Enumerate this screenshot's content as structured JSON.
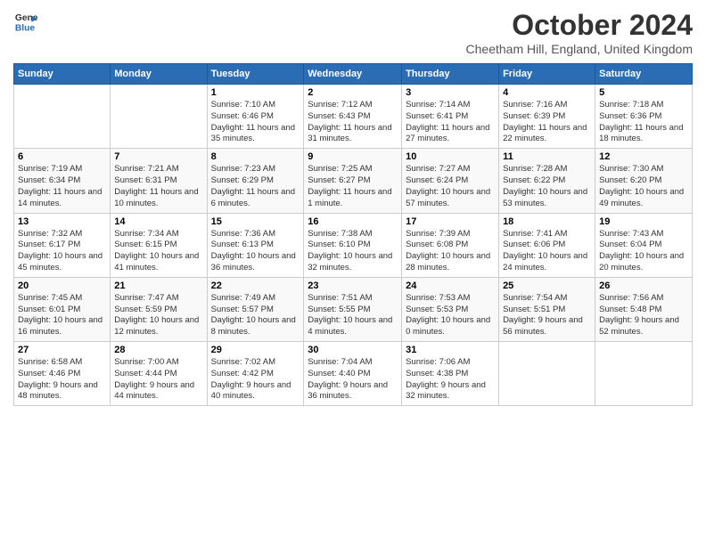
{
  "logo": {
    "line1": "General",
    "line2": "Blue"
  },
  "title": "October 2024",
  "subtitle": "Cheetham Hill, England, United Kingdom",
  "days_header": [
    "Sunday",
    "Monday",
    "Tuesday",
    "Wednesday",
    "Thursday",
    "Friday",
    "Saturday"
  ],
  "weeks": [
    [
      {
        "day": "",
        "info": ""
      },
      {
        "day": "",
        "info": ""
      },
      {
        "day": "1",
        "info": "Sunrise: 7:10 AM\nSunset: 6:46 PM\nDaylight: 11 hours and 35 minutes."
      },
      {
        "day": "2",
        "info": "Sunrise: 7:12 AM\nSunset: 6:43 PM\nDaylight: 11 hours and 31 minutes."
      },
      {
        "day": "3",
        "info": "Sunrise: 7:14 AM\nSunset: 6:41 PM\nDaylight: 11 hours and 27 minutes."
      },
      {
        "day": "4",
        "info": "Sunrise: 7:16 AM\nSunset: 6:39 PM\nDaylight: 11 hours and 22 minutes."
      },
      {
        "day": "5",
        "info": "Sunrise: 7:18 AM\nSunset: 6:36 PM\nDaylight: 11 hours and 18 minutes."
      }
    ],
    [
      {
        "day": "6",
        "info": "Sunrise: 7:19 AM\nSunset: 6:34 PM\nDaylight: 11 hours and 14 minutes."
      },
      {
        "day": "7",
        "info": "Sunrise: 7:21 AM\nSunset: 6:31 PM\nDaylight: 11 hours and 10 minutes."
      },
      {
        "day": "8",
        "info": "Sunrise: 7:23 AM\nSunset: 6:29 PM\nDaylight: 11 hours and 6 minutes."
      },
      {
        "day": "9",
        "info": "Sunrise: 7:25 AM\nSunset: 6:27 PM\nDaylight: 11 hours and 1 minute."
      },
      {
        "day": "10",
        "info": "Sunrise: 7:27 AM\nSunset: 6:24 PM\nDaylight: 10 hours and 57 minutes."
      },
      {
        "day": "11",
        "info": "Sunrise: 7:28 AM\nSunset: 6:22 PM\nDaylight: 10 hours and 53 minutes."
      },
      {
        "day": "12",
        "info": "Sunrise: 7:30 AM\nSunset: 6:20 PM\nDaylight: 10 hours and 49 minutes."
      }
    ],
    [
      {
        "day": "13",
        "info": "Sunrise: 7:32 AM\nSunset: 6:17 PM\nDaylight: 10 hours and 45 minutes."
      },
      {
        "day": "14",
        "info": "Sunrise: 7:34 AM\nSunset: 6:15 PM\nDaylight: 10 hours and 41 minutes."
      },
      {
        "day": "15",
        "info": "Sunrise: 7:36 AM\nSunset: 6:13 PM\nDaylight: 10 hours and 36 minutes."
      },
      {
        "day": "16",
        "info": "Sunrise: 7:38 AM\nSunset: 6:10 PM\nDaylight: 10 hours and 32 minutes."
      },
      {
        "day": "17",
        "info": "Sunrise: 7:39 AM\nSunset: 6:08 PM\nDaylight: 10 hours and 28 minutes."
      },
      {
        "day": "18",
        "info": "Sunrise: 7:41 AM\nSunset: 6:06 PM\nDaylight: 10 hours and 24 minutes."
      },
      {
        "day": "19",
        "info": "Sunrise: 7:43 AM\nSunset: 6:04 PM\nDaylight: 10 hours and 20 minutes."
      }
    ],
    [
      {
        "day": "20",
        "info": "Sunrise: 7:45 AM\nSunset: 6:01 PM\nDaylight: 10 hours and 16 minutes."
      },
      {
        "day": "21",
        "info": "Sunrise: 7:47 AM\nSunset: 5:59 PM\nDaylight: 10 hours and 12 minutes."
      },
      {
        "day": "22",
        "info": "Sunrise: 7:49 AM\nSunset: 5:57 PM\nDaylight: 10 hours and 8 minutes."
      },
      {
        "day": "23",
        "info": "Sunrise: 7:51 AM\nSunset: 5:55 PM\nDaylight: 10 hours and 4 minutes."
      },
      {
        "day": "24",
        "info": "Sunrise: 7:53 AM\nSunset: 5:53 PM\nDaylight: 10 hours and 0 minutes."
      },
      {
        "day": "25",
        "info": "Sunrise: 7:54 AM\nSunset: 5:51 PM\nDaylight: 9 hours and 56 minutes."
      },
      {
        "day": "26",
        "info": "Sunrise: 7:56 AM\nSunset: 5:48 PM\nDaylight: 9 hours and 52 minutes."
      }
    ],
    [
      {
        "day": "27",
        "info": "Sunrise: 6:58 AM\nSunset: 4:46 PM\nDaylight: 9 hours and 48 minutes."
      },
      {
        "day": "28",
        "info": "Sunrise: 7:00 AM\nSunset: 4:44 PM\nDaylight: 9 hours and 44 minutes."
      },
      {
        "day": "29",
        "info": "Sunrise: 7:02 AM\nSunset: 4:42 PM\nDaylight: 9 hours and 40 minutes."
      },
      {
        "day": "30",
        "info": "Sunrise: 7:04 AM\nSunset: 4:40 PM\nDaylight: 9 hours and 36 minutes."
      },
      {
        "day": "31",
        "info": "Sunrise: 7:06 AM\nSunset: 4:38 PM\nDaylight: 9 hours and 32 minutes."
      },
      {
        "day": "",
        "info": ""
      },
      {
        "day": "",
        "info": ""
      }
    ]
  ]
}
